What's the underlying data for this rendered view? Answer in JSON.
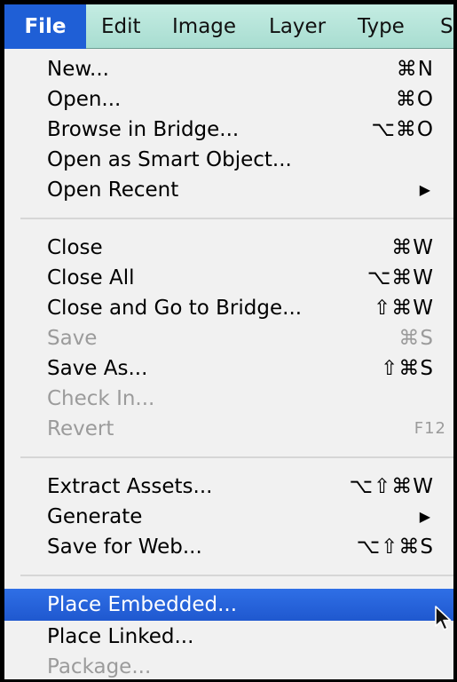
{
  "menubar": {
    "items": [
      {
        "label": "File"
      },
      {
        "label": "Edit"
      },
      {
        "label": "Image"
      },
      {
        "label": "Layer"
      },
      {
        "label": "Type"
      },
      {
        "label": "S"
      }
    ]
  },
  "menu": {
    "groups": [
      {
        "items": [
          {
            "label": "New...",
            "shortcut": "⌘N"
          },
          {
            "label": "Open...",
            "shortcut": "⌘O"
          },
          {
            "label": "Browse in Bridge...",
            "shortcut": "⌥⌘O"
          },
          {
            "label": "Open as Smart Object..."
          },
          {
            "label": "Open Recent",
            "submenu_arrow": "▶"
          }
        ]
      },
      {
        "items": [
          {
            "label": "Close",
            "shortcut": "⌘W"
          },
          {
            "label": "Close All",
            "shortcut": "⌥⌘W"
          },
          {
            "label": "Close and Go to Bridge...",
            "shortcut": "⇧⌘W"
          },
          {
            "label": "Save",
            "shortcut": "⌘S",
            "disabled": true
          },
          {
            "label": "Save As...",
            "shortcut": "⇧⌘S"
          },
          {
            "label": "Check In...",
            "disabled": true
          },
          {
            "label": "Revert",
            "shortcut": "F12",
            "disabled": true
          }
        ]
      },
      {
        "items": [
          {
            "label": "Extract Assets...",
            "shortcut": "⌥⇧⌘W"
          },
          {
            "label": "Generate",
            "submenu_arrow": "▶"
          },
          {
            "label": "Save for Web...",
            "shortcut": "⌥⇧⌘S"
          }
        ]
      },
      {
        "items": [
          {
            "label": "Place Embedded...",
            "highlighted": true
          },
          {
            "label": "Place Linked..."
          },
          {
            "label": "Package...",
            "disabled": true
          }
        ]
      }
    ]
  },
  "colors": {
    "menubar_bg": "#b6e4d9",
    "menubar_active": "#1f5fd6",
    "menu_bg": "#f1f1f1",
    "highlight": "#2563dc",
    "disabled_text": "#9b9b9b"
  },
  "icons": {
    "cursor": "arrow-cursor-icon",
    "submenu": "triangle-right-icon"
  }
}
